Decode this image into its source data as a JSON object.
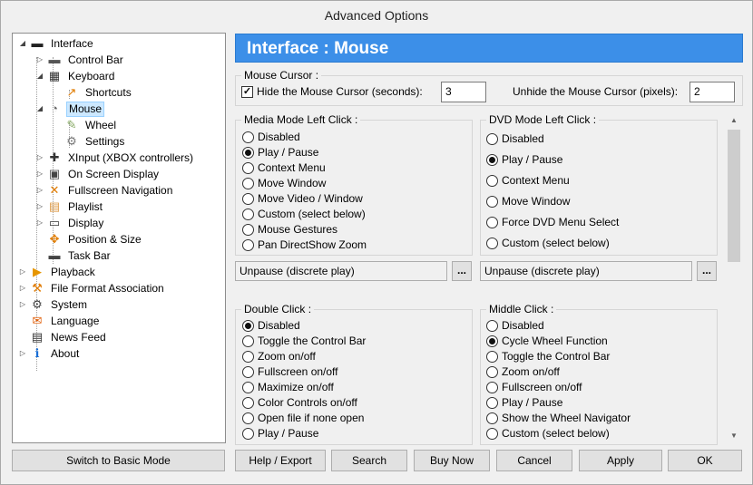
{
  "window": {
    "title": "Advanced Options"
  },
  "tree": [
    {
      "label": "Interface",
      "icon": "interface-icon",
      "expander": "◢"
    },
    {
      "label": "Control Bar",
      "icon": "control-bar-icon",
      "expander": "▷"
    },
    {
      "label": "Keyboard",
      "icon": "keyboard-icon",
      "expander": "◢"
    },
    {
      "label": "Shortcuts",
      "icon": "shortcuts-icon",
      "expander": ""
    },
    {
      "label": "Mouse",
      "icon": "mouse-icon",
      "expander": "◢"
    },
    {
      "label": "Wheel",
      "icon": "wheel-icon",
      "expander": ""
    },
    {
      "label": "Settings",
      "icon": "settings-icon",
      "expander": ""
    },
    {
      "label": "XInput (XBOX controllers)",
      "icon": "gamepad-icon",
      "expander": "▷"
    },
    {
      "label": "On Screen Display",
      "icon": "osd-icon",
      "expander": "▷"
    },
    {
      "label": "Fullscreen Navigation",
      "icon": "fullscreen-icon",
      "expander": "▷"
    },
    {
      "label": "Playlist",
      "icon": "playlist-icon",
      "expander": "▷"
    },
    {
      "label": "Display",
      "icon": "display-icon",
      "expander": "▷"
    },
    {
      "label": "Position & Size",
      "icon": "position-icon",
      "expander": ""
    },
    {
      "label": "Task Bar",
      "icon": "taskbar-icon",
      "expander": ""
    },
    {
      "label": "Playback",
      "icon": "playback-icon",
      "expander": "▷"
    },
    {
      "label": "File Format Association",
      "icon": "file-association-icon",
      "expander": "▷"
    },
    {
      "label": "System",
      "icon": "system-gear-icon",
      "expander": "▷"
    },
    {
      "label": "Language",
      "icon": "language-icon",
      "expander": ""
    },
    {
      "label": "News Feed",
      "icon": "news-icon",
      "expander": ""
    },
    {
      "label": "About",
      "icon": "info-icon",
      "expander": "▷"
    }
  ],
  "pane": {
    "title": "Interface : Mouse",
    "cursor": {
      "legend": "Mouse Cursor :",
      "hide_label": "Hide the Mouse Cursor (seconds):",
      "hide_checked": true,
      "hide_value": "3",
      "unhide_label": "Unhide the Mouse Cursor (pixels):",
      "unhide_value": "2"
    },
    "media_left": {
      "legend": "Media Mode Left Click :",
      "options": [
        "Disabled",
        "Play / Pause",
        "Context Menu",
        "Move Window",
        "Move Video / Window",
        "Custom (select below)",
        "Mouse Gestures",
        "Pan DirectShow Zoom"
      ],
      "selected": 1,
      "combo": "Unpause (discrete play)"
    },
    "dvd_left": {
      "legend": "DVD Mode Left Click :",
      "options": [
        "Disabled",
        "Play / Pause",
        "Context Menu",
        "Move Window",
        "Force DVD Menu Select",
        "Custom (select below)"
      ],
      "selected": 1,
      "combo": "Unpause (discrete play)"
    },
    "double_click": {
      "legend": "Double Click :",
      "options": [
        "Disabled",
        "Toggle the Control Bar",
        "Zoom on/off",
        "Fullscreen on/off",
        "Maximize on/off",
        "Color Controls on/off",
        "Open file if none open",
        "Play / Pause"
      ],
      "selected": 0
    },
    "middle_click": {
      "legend": "Middle Click :",
      "options": [
        "Disabled",
        "Cycle Wheel Function",
        "Toggle the Control Bar",
        "Zoom on/off",
        "Fullscreen on/off",
        "Play / Pause",
        "Show the Wheel Navigator",
        "Custom (select below)"
      ],
      "selected": 1
    },
    "ellipsis": "..."
  },
  "buttons": {
    "basic_mode": "Switch to Basic Mode",
    "help_export": "Help / Export",
    "search": "Search",
    "buy_now": "Buy Now",
    "cancel": "Cancel",
    "apply": "Apply",
    "ok": "OK"
  },
  "colors": {
    "header_bg": "#3c8fe8",
    "selection_bg": "#cce8ff"
  }
}
